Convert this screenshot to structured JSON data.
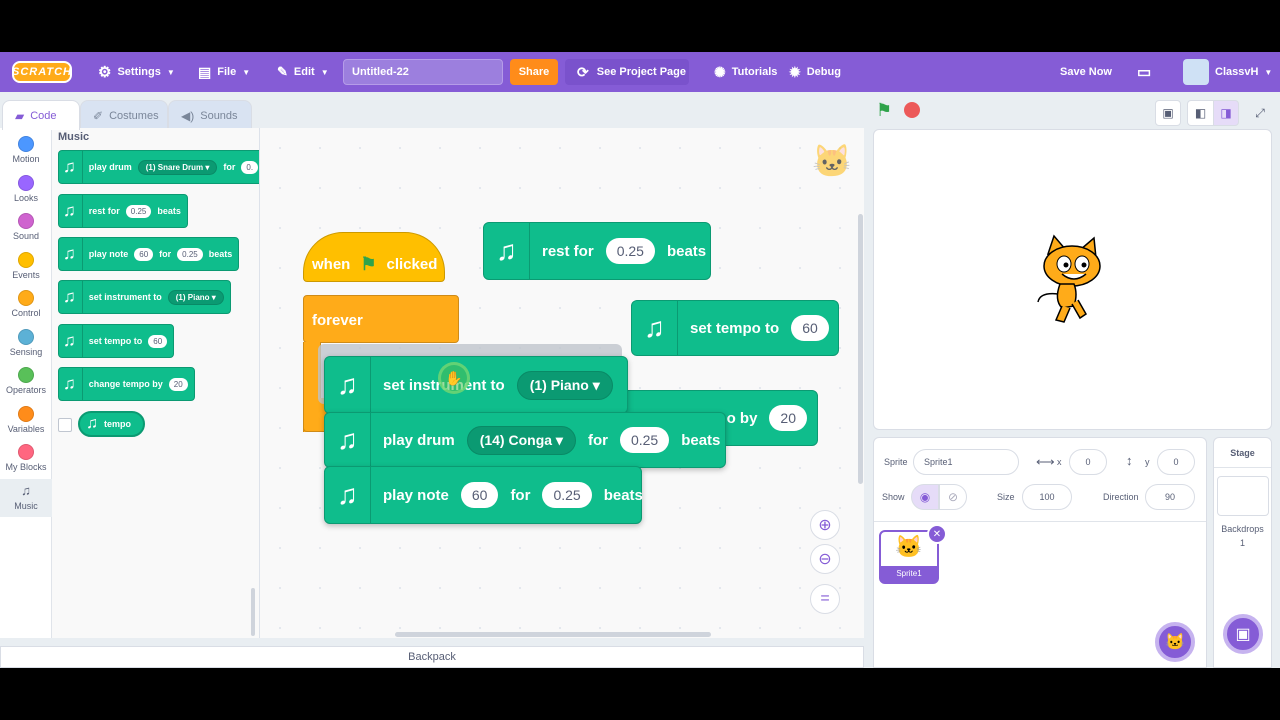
{
  "menubar": {
    "logo": "SCRATCH",
    "settings": "Settings",
    "file": "File",
    "edit": "Edit",
    "project_title": "Untitled-22",
    "share": "Share",
    "see_project_page": "See Project Page",
    "tutorials": "Tutorials",
    "debug": "Debug",
    "save_now": "Save Now",
    "username": "ClassvH"
  },
  "tabs": {
    "code": "Code",
    "costumes": "Costumes",
    "sounds": "Sounds"
  },
  "categories": [
    {
      "label": "Motion",
      "color": "#4c97ff"
    },
    {
      "label": "Looks",
      "color": "#9966ff"
    },
    {
      "label": "Sound",
      "color": "#cf63cf"
    },
    {
      "label": "Events",
      "color": "#ffbf00"
    },
    {
      "label": "Control",
      "color": "#ffab19"
    },
    {
      "label": "Sensing",
      "color": "#5cb1d6"
    },
    {
      "label": "Operators",
      "color": "#59c059"
    },
    {
      "label": "Variables",
      "color": "#ff8c1a"
    },
    {
      "label": "My Blocks",
      "color": "#ff6680"
    },
    {
      "label": "Music",
      "color": "#0fbd8c"
    }
  ],
  "palette": {
    "title": "Music",
    "play_drum": {
      "label": "play drum",
      "drum": "(1) Snare Drum",
      "for": "for",
      "value": "0."
    },
    "rest_for": {
      "label": "rest for",
      "value": "0.25",
      "unit": "beats"
    },
    "play_note": {
      "label": "play note",
      "note": "60",
      "for": "for",
      "value": "0.25",
      "unit": "beats"
    },
    "set_instrument": {
      "label": "set instrument to",
      "instrument": "(1) Piano"
    },
    "set_tempo": {
      "label": "set tempo to",
      "value": "60"
    },
    "change_tempo": {
      "label": "change tempo by",
      "value": "20"
    },
    "tempo": {
      "label": "tempo"
    }
  },
  "workspace": {
    "when_flag": {
      "when": "when",
      "clicked": "clicked"
    },
    "forever": "forever",
    "rest_for": {
      "label": "rest for",
      "value": "0.25",
      "unit": "beats"
    },
    "set_tempo": {
      "label": "set tempo to",
      "value": "60"
    },
    "change_tempo": {
      "label": "po by",
      "value": "20"
    },
    "set_instrument": {
      "label": "set instrument to",
      "instrument": "(1) Piano"
    },
    "play_drum": {
      "label": "play drum",
      "drum": "(14) Conga",
      "for": "for",
      "value": "0.25",
      "unit": "beats"
    },
    "play_note": {
      "label": "play note",
      "note": "60",
      "for": "for",
      "value": "0.25",
      "unit": "beats"
    },
    "zoom_reset": "="
  },
  "backpack": "Backpack",
  "sprite_info": {
    "sprite_label": "Sprite",
    "sprite_name": "Sprite1",
    "x_label": "x",
    "x_value": "0",
    "y_label": "y",
    "y_value": "0",
    "show_label": "Show",
    "size_label": "Size",
    "size_value": "100",
    "direction_label": "Direction",
    "direction_value": "90"
  },
  "sprite_list": [
    {
      "name": "Sprite1"
    }
  ],
  "stage_panel": {
    "title": "Stage",
    "backdrops_label": "Backdrops",
    "backdrops_count": "1"
  },
  "colors": {
    "accent": "#855cd6",
    "music": "#0fbd8c",
    "events": "#ffbf00",
    "control": "#ffab19",
    "share": "#ff8c1a"
  }
}
